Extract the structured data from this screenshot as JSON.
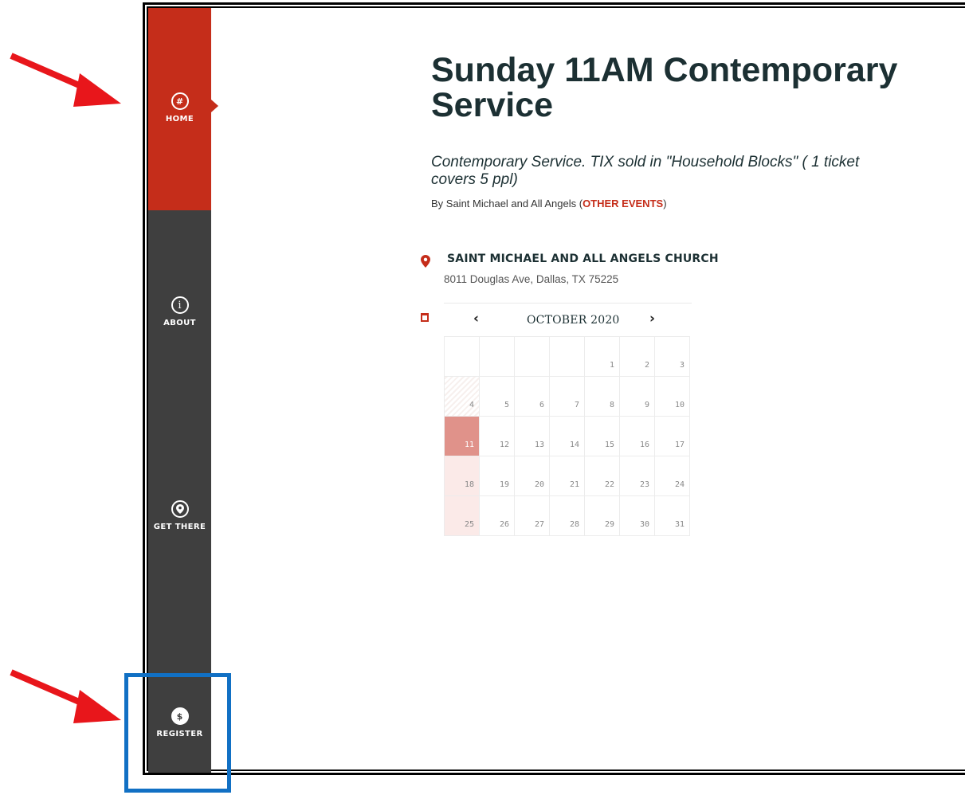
{
  "sidebar": {
    "items": [
      {
        "label": "HOME",
        "icon": "hash-icon",
        "glyph": "#"
      },
      {
        "label": "ABOUT",
        "icon": "info-icon",
        "glyph": "i"
      },
      {
        "label": "GET THERE",
        "icon": "location-pin-icon",
        "glyph": "●"
      },
      {
        "label": "REGISTER",
        "icon": "dollar-icon",
        "glyph": "$"
      }
    ]
  },
  "event": {
    "title": "Sunday 11AM Contemporary Service",
    "subtitle": "Contemporary Service. TIX sold in \"Household Blocks\" ( 1 ticket covers 5 ppl)",
    "byline_prefix": "By Saint Michael and All Angels (",
    "other_events": "OTHER EVENTS",
    "byline_suffix": ")"
  },
  "venue": {
    "name": "SAINT MICHAEL AND ALL ANGELS CHURCH",
    "address": "8011 Douglas Ave, Dallas, TX 75225"
  },
  "calendar": {
    "month": "OCTOBER 2020",
    "prev": "‹",
    "next": "›",
    "weeks": [
      [
        "",
        "",
        "",
        "",
        "1",
        "2",
        "3"
      ],
      [
        "4",
        "5",
        "6",
        "7",
        "8",
        "9",
        "10"
      ],
      [
        "11",
        "12",
        "13",
        "14",
        "15",
        "16",
        "17"
      ],
      [
        "18",
        "19",
        "20",
        "21",
        "22",
        "23",
        "24"
      ],
      [
        "25",
        "26",
        "27",
        "28",
        "29",
        "30",
        "31"
      ]
    ],
    "selected_day": "11",
    "available_days": [
      "18",
      "25"
    ],
    "past_days": [
      "4"
    ]
  },
  "colors": {
    "accent": "#c52d1a",
    "sidebar": "#3f3f3f",
    "title": "#1c3033",
    "annotation_arrow": "#e8161b",
    "annotation_box": "#1170c4"
  }
}
